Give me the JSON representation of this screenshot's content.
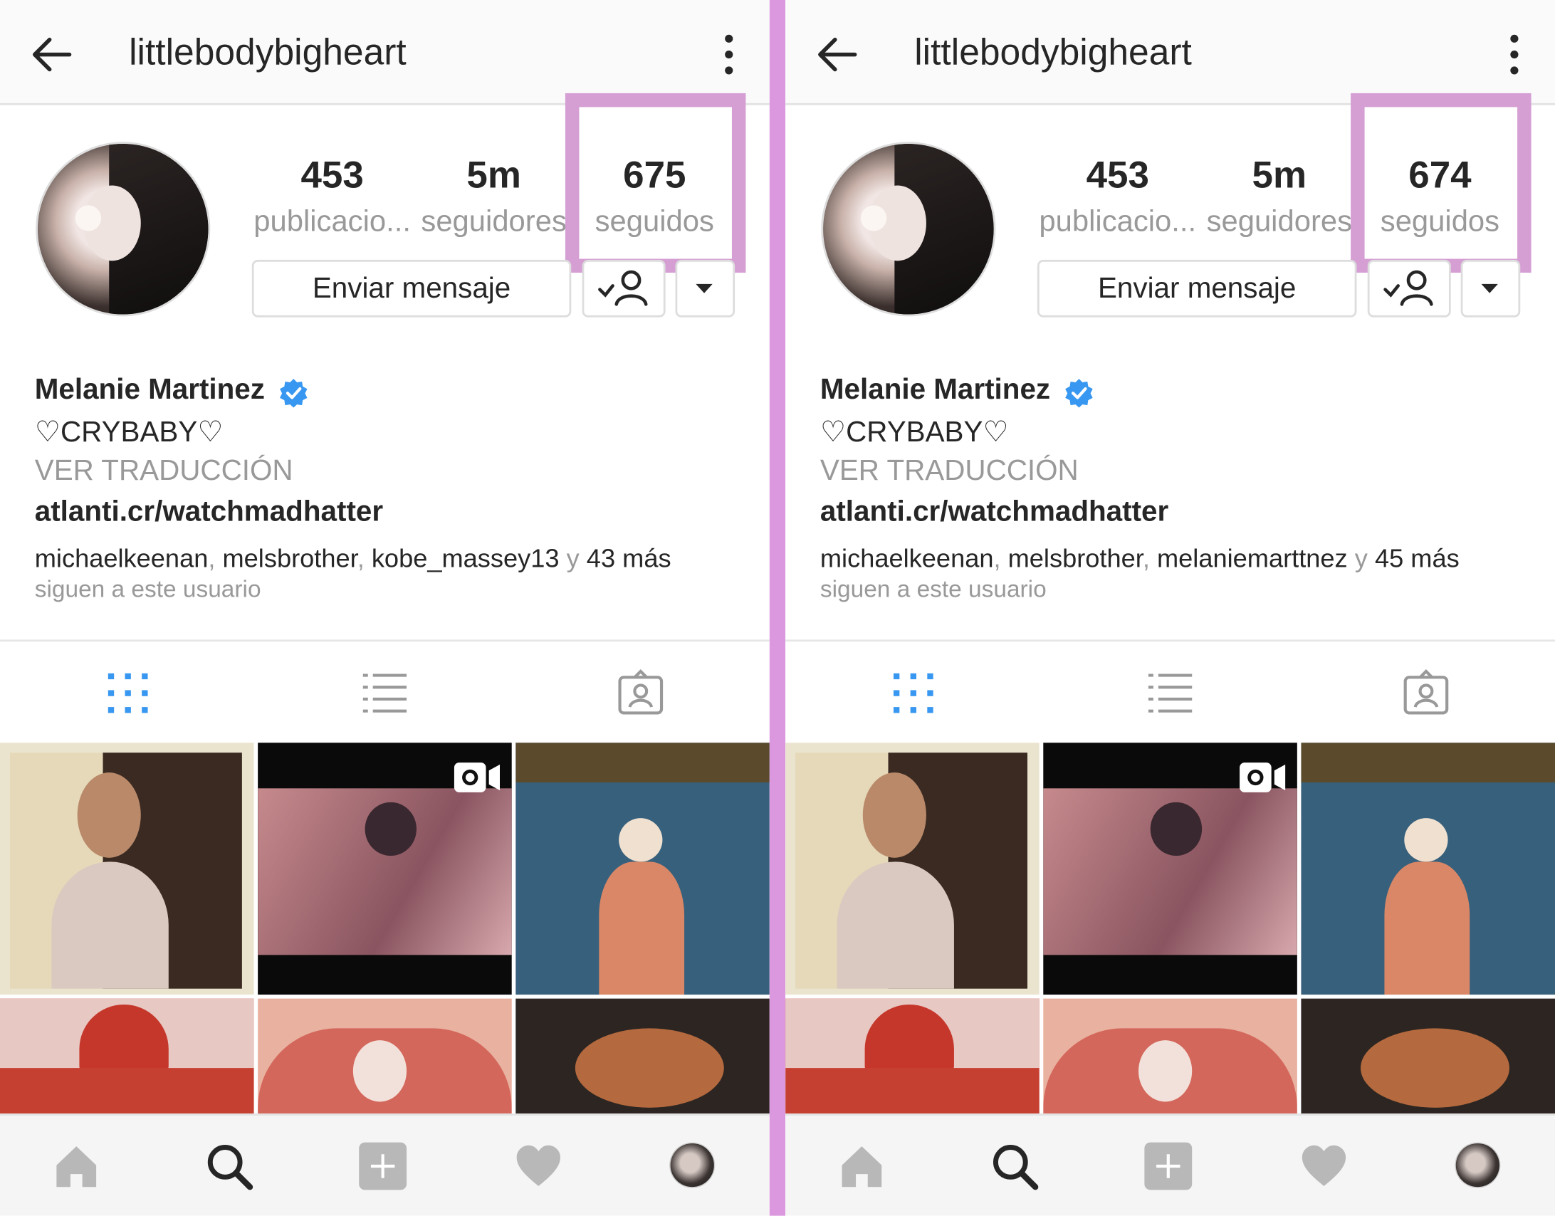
{
  "panels": [
    {
      "header": {
        "username": "littlebodybigheart"
      },
      "stats": [
        {
          "value": "453",
          "label": "publicacio..."
        },
        {
          "value": "5m",
          "label": "seguidores"
        },
        {
          "value": "675",
          "label": "seguidos"
        }
      ],
      "actions": {
        "message_label": "Enviar mensaje"
      },
      "profile": {
        "full_name": "Melanie Martinez",
        "bio": "♡CRYBABY♡",
        "translate_label": "VER TRADUCCIÓN",
        "link": "atlanti.cr/watchmadhatter",
        "followed_by": {
          "user1": "michaelkeenan",
          "user2": "melsbrother",
          "user3": "kobe_massey13",
          "and": "y",
          "more": "43 más",
          "suffix": "siguen a este usuario"
        }
      }
    },
    {
      "header": {
        "username": "littlebodybigheart"
      },
      "stats": [
        {
          "value": "453",
          "label": "publicacio..."
        },
        {
          "value": "5m",
          "label": "seguidores"
        },
        {
          "value": "674",
          "label": "seguidos"
        }
      ],
      "actions": {
        "message_label": "Enviar mensaje"
      },
      "profile": {
        "full_name": "Melanie Martinez",
        "bio": "♡CRYBABY♡",
        "translate_label": "VER TRADUCCIÓN",
        "link": "atlanti.cr/watchmadhatter",
        "followed_by": {
          "user1": "michaelkeenan",
          "user2": "melsbrother",
          "user3": "melaniemarttnez",
          "and": "y",
          "more": "45 más",
          "suffix": "siguen a este usuario"
        }
      }
    }
  ],
  "icons": {
    "header": [
      "back-arrow-icon",
      "more-options-icon"
    ],
    "tabs": [
      "grid-view-icon",
      "list-view-icon",
      "tagged-photos-icon"
    ],
    "bottom_nav": [
      "home-icon",
      "search-icon",
      "add-post-icon",
      "activity-heart-icon",
      "profile-avatar"
    ],
    "profile": [
      "verified-badge-icon",
      "following-check-icon",
      "dropdown-caret-icon",
      "video-camera-icon"
    ]
  },
  "colors": {
    "highlight": "#d59fd4",
    "divider": "#dc98df",
    "verified": "#3897f0",
    "active_tab": "#3897f0",
    "text": "#262626",
    "muted": "#999999"
  }
}
